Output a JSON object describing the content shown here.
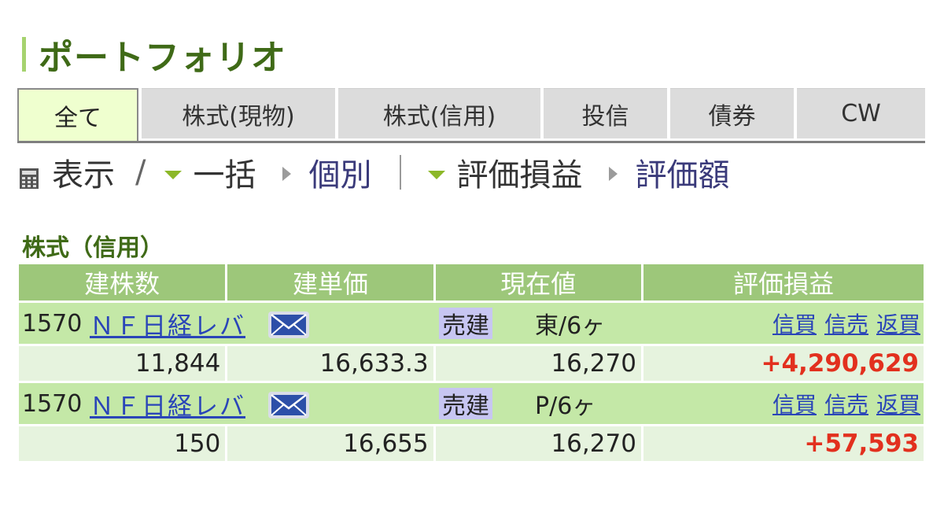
{
  "page": {
    "title": "ポートフォリオ"
  },
  "tabs": [
    {
      "label": "全て",
      "active": true
    },
    {
      "label": "株式(現物)",
      "active": false
    },
    {
      "label": "株式(信用)",
      "active": false
    },
    {
      "label": "投信",
      "active": false
    },
    {
      "label": "債券",
      "active": false
    },
    {
      "label": "CW",
      "active": false
    }
  ],
  "display": {
    "label": "表示",
    "separator": "/",
    "mode_options": [
      "一括",
      "個別"
    ],
    "metric_options": [
      "評価損益",
      "評価額"
    ]
  },
  "section": {
    "title": "株式（信用）",
    "headers": [
      "建株数",
      "建単価",
      "現在値",
      "評価損益"
    ],
    "rows": [
      {
        "code": "1570",
        "name": "ＮＦ日経レバ",
        "position": "売建",
        "market": "東/6ヶ",
        "actions": [
          "信買",
          "信売",
          "返買"
        ],
        "quantity": "11,844",
        "unit_price": "16,633.3",
        "current_price": "16,270",
        "pl": "+4,290,629"
      },
      {
        "code": "1570",
        "name": "ＮＦ日経レバ",
        "position": "売建",
        "market": "P/6ヶ",
        "actions": [
          "信買",
          "信売",
          "返買"
        ],
        "quantity": "150",
        "unit_price": "16,655",
        "current_price": "16,270",
        "pl": "+57,593"
      }
    ]
  },
  "colors": {
    "accent_green": "#3f6a17",
    "header_green": "#9dc77a",
    "profit_red": "#e2301e",
    "link_blue": "#2a45b8"
  },
  "icons": [
    "calculator-icon",
    "dropdown-triangle-icon",
    "right-arrow-icon",
    "mail-icon"
  ]
}
